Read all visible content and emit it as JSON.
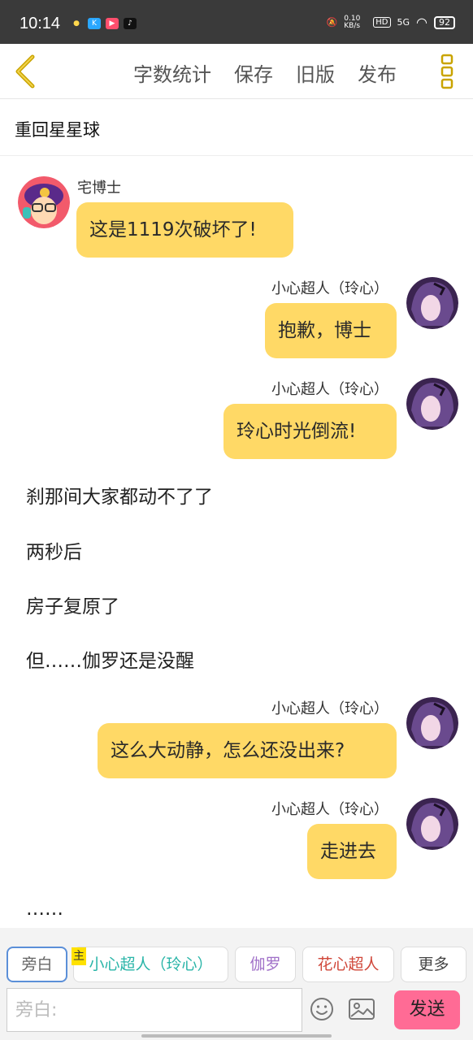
{
  "status_bar": {
    "time": "10:14",
    "net_speed": "0.10 KB/s",
    "hd": "HD",
    "signal": "5G",
    "battery": "92"
  },
  "toolbar": {
    "word_count_label": "字数统计",
    "save_label": "保存",
    "old_version_label": "旧版",
    "publish_label": "发布"
  },
  "story_title": "重回星星球",
  "messages": [
    {
      "side": "left",
      "name": "宅博士",
      "text": "这是1119次破坏了!"
    },
    {
      "side": "right",
      "name": "小心超人（玲心）",
      "text": "抱歉，博士"
    },
    {
      "side": "right",
      "name": "小心超人（玲心）",
      "text": "玲心时光倒流!"
    },
    {
      "side": "narration",
      "text": "刹那间大家都动不了了"
    },
    {
      "side": "narration",
      "text": "两秒后"
    },
    {
      "side": "narration",
      "text": "房子复原了"
    },
    {
      "side": "narration",
      "text": "但……伽罗还是没醒"
    },
    {
      "side": "right",
      "name": "小心超人（玲心）",
      "text": "这么大动静，怎么还没出来?"
    },
    {
      "side": "right",
      "name": "小心超人（玲心）",
      "text": "走进去"
    },
    {
      "side": "narration",
      "text": "……"
    }
  ],
  "characters": [
    {
      "label": "旁白",
      "color": "#666666"
    },
    {
      "label": "小心超人（玲心）",
      "color": "#2ab5a8",
      "badge": "主"
    },
    {
      "label": "伽罗",
      "color": "#a070c8"
    },
    {
      "label": "花心超人",
      "color": "#d0473a"
    },
    {
      "label": "更多",
      "color": "#444444"
    }
  ],
  "composer": {
    "placeholder": "旁白:",
    "send_label": "发送"
  },
  "colors": {
    "bubble": "#ffd966",
    "send": "#ff6b95",
    "back_arrow": "#c9a400",
    "menu_dots": "#c9a400"
  }
}
